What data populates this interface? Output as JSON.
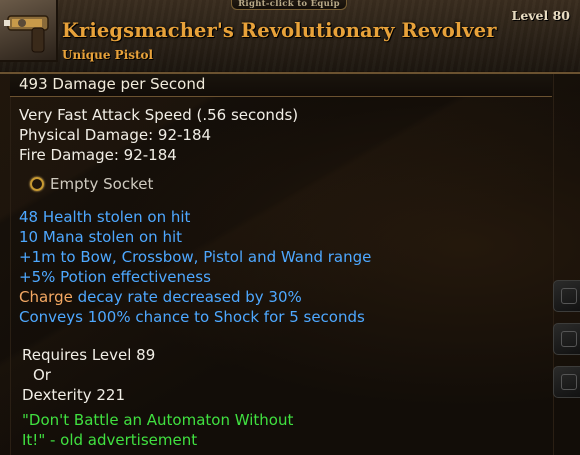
{
  "header": {
    "hint": "Right-click to Equip",
    "item_name": "Kriegsmacher's Revolutionary Revolver",
    "item_type": "Unique Pistol",
    "level": "Level 80"
  },
  "stats": {
    "dps": "493  Damage per Second",
    "base": [
      "Very Fast Attack Speed (.56 seconds)",
      "Physical Damage: 92-184",
      "Fire Damage: 92-184"
    ],
    "socket": "Empty Socket",
    "modifiers": [
      "48 Health stolen on hit",
      "10 Mana stolen on hit",
      "+1m to Bow, Crossbow, Pistol and Wand range",
      "+5% Potion effectiveness"
    ],
    "charge_word": "Charge",
    "charge_rest": " decay rate decreased by 30%",
    "shock": "Conveys 100% chance to Shock for 5 seconds"
  },
  "requirements": {
    "line1": "Requires Level 89",
    "line2": "Or",
    "line3": "Dexterity 221"
  },
  "flavor": {
    "line1": "\"Don't Battle an Automaton Without",
    "line2": "It!\" - old advertisement"
  },
  "icons": {
    "item": "pistol-icon",
    "socket": "socket-ring-icon"
  },
  "colors": {
    "name": "#e8a23a",
    "stat_white": "#f1eee6",
    "modifier_blue": "#4ea8ff",
    "charge_orange": "#f4a862",
    "flavor_green": "#40e040"
  }
}
